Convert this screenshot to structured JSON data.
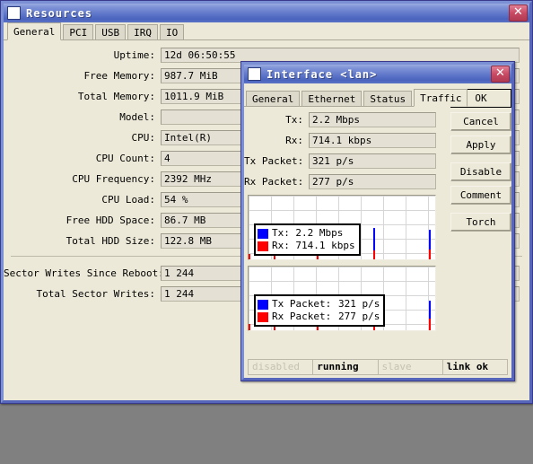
{
  "colors": {
    "title_gradient_start": "#9aabe0",
    "title_gradient_end": "#4a63bd",
    "window_face": "#ece9d8",
    "field_face": "#e4e1d4",
    "tx_blue": "#0000ff",
    "rx_red": "#ff0000",
    "desktop": "#808080"
  },
  "resources": {
    "title": "Resources",
    "title_icon": "window-icon",
    "close_icon": "close-icon",
    "tabs": [
      {
        "label": "General",
        "active": true
      },
      {
        "label": "PCI",
        "active": false
      },
      {
        "label": "USB",
        "active": false
      },
      {
        "label": "IRQ",
        "active": false
      },
      {
        "label": "IO",
        "active": false
      }
    ],
    "fields": [
      {
        "label": "Uptime:",
        "value": "12d 06:50:55"
      },
      {
        "label": "Free Memory:",
        "value": "987.7 MiB"
      },
      {
        "label": "Total Memory:",
        "value": "1011.9 MiB"
      },
      {
        "label": "Model:",
        "value": ""
      },
      {
        "label": "CPU:",
        "value": "Intel(R)"
      },
      {
        "label": "CPU Count:",
        "value": "4"
      },
      {
        "label": "CPU Frequency:",
        "value": "2392 MHz"
      },
      {
        "label": "CPU Load:",
        "value": "54 %"
      },
      {
        "label": "Free HDD Space:",
        "value": "86.7 MB"
      },
      {
        "label": "Total HDD Size:",
        "value": "122.8 MB"
      }
    ],
    "fields2": [
      {
        "label": "Sector Writes Since Reboot:",
        "value": "1 244"
      },
      {
        "label": "Total Sector Writes:",
        "value": "1 244"
      }
    ]
  },
  "interface": {
    "title": "Interface <lan>",
    "title_icon": "window-icon",
    "close_icon": "close-icon",
    "tabs": [
      {
        "label": "General",
        "active": false
      },
      {
        "label": "Ethernet",
        "active": false
      },
      {
        "label": "Status",
        "active": false
      },
      {
        "label": "Traffic",
        "active": true
      }
    ],
    "fields": [
      {
        "label": "Tx:",
        "value": "2.2 Mbps"
      },
      {
        "label": "Rx:",
        "value": "714.1 kbps"
      },
      {
        "label": "Tx Packet:",
        "value": "321 p/s"
      },
      {
        "label": "Rx Packet:",
        "value": "277 p/s"
      }
    ],
    "buttons": [
      {
        "label": "OK",
        "default": true,
        "gap": false
      },
      {
        "label": "Cancel",
        "default": false,
        "gap": false
      },
      {
        "label": "Apply",
        "default": false,
        "gap": false
      },
      {
        "label": "Disable",
        "default": false,
        "gap": true
      },
      {
        "label": "Comment",
        "default": false,
        "gap": false
      },
      {
        "label": "Torch",
        "default": false,
        "gap": true
      }
    ],
    "status": [
      {
        "label": "disabled",
        "active": false
      },
      {
        "label": "running",
        "active": true
      },
      {
        "label": "slave",
        "active": false
      },
      {
        "label": "link ok",
        "active": true
      }
    ]
  },
  "chart_data": [
    {
      "type": "bar",
      "id": "traffic-rate-graph",
      "title": "",
      "xlabel": "",
      "ylabel": "",
      "grid": true,
      "legend_position": "left",
      "series": [
        {
          "name": "Tx:",
          "value_label": "2.2 Mbps",
          "color": "#0000ff",
          "values": [
            0,
            0,
            0,
            0,
            0,
            0,
            0,
            0,
            2,
            0,
            0,
            0,
            0,
            0,
            0,
            0,
            0,
            0,
            0,
            0,
            0,
            0,
            0,
            0,
            0,
            0,
            0,
            0,
            0,
            0,
            0,
            0,
            0,
            0,
            0,
            0,
            0,
            0,
            0,
            0,
            36,
            0,
            0,
            0,
            0,
            0,
            0,
            0,
            0,
            0,
            0,
            0,
            0,
            0,
            0,
            0,
            0,
            0,
            34,
            0
          ]
        },
        {
          "name": "Rx:",
          "value_label": "714.1 kbps",
          "color": "#ff0000",
          "values": [
            6,
            0,
            0,
            0,
            0,
            0,
            0,
            0,
            6,
            0,
            0,
            0,
            0,
            0,
            0,
            0,
            0,
            0,
            0,
            0,
            0,
            0,
            6,
            0,
            0,
            0,
            0,
            0,
            0,
            0,
            0,
            0,
            0,
            0,
            0,
            0,
            0,
            0,
            0,
            0,
            10,
            0,
            0,
            0,
            0,
            0,
            0,
            0,
            0,
            0,
            0,
            0,
            0,
            0,
            0,
            0,
            0,
            0,
            11,
            0
          ]
        }
      ],
      "ylim": [
        0,
        73
      ]
    },
    {
      "type": "bar",
      "id": "packet-rate-graph",
      "title": "",
      "xlabel": "",
      "ylabel": "",
      "grid": true,
      "legend_position": "left",
      "series": [
        {
          "name": "Tx Packet:",
          "value_label": "321 p/s",
          "color": "#0000ff",
          "values": [
            0,
            0,
            0,
            0,
            0,
            0,
            0,
            0,
            2,
            0,
            0,
            0,
            0,
            0,
            0,
            0,
            0,
            0,
            0,
            0,
            0,
            0,
            0,
            0,
            0,
            0,
            0,
            0,
            0,
            0,
            0,
            0,
            0,
            0,
            0,
            0,
            0,
            0,
            0,
            0,
            36,
            0,
            0,
            0,
            0,
            0,
            0,
            0,
            0,
            0,
            0,
            0,
            0,
            0,
            0,
            0,
            0,
            0,
            34,
            0
          ]
        },
        {
          "name": "Rx Packet:",
          "value_label": "277 p/s",
          "color": "#ff0000",
          "values": [
            7,
            0,
            0,
            0,
            0,
            0,
            0,
            0,
            7,
            0,
            0,
            0,
            0,
            0,
            0,
            0,
            0,
            0,
            0,
            0,
            0,
            0,
            7,
            0,
            0,
            0,
            0,
            0,
            0,
            0,
            0,
            0,
            0,
            0,
            0,
            0,
            0,
            0,
            0,
            0,
            12,
            0,
            0,
            0,
            0,
            0,
            0,
            0,
            0,
            0,
            0,
            0,
            0,
            0,
            0,
            0,
            0,
            0,
            13,
            0
          ]
        }
      ],
      "ylim": [
        0,
        73
      ]
    }
  ]
}
